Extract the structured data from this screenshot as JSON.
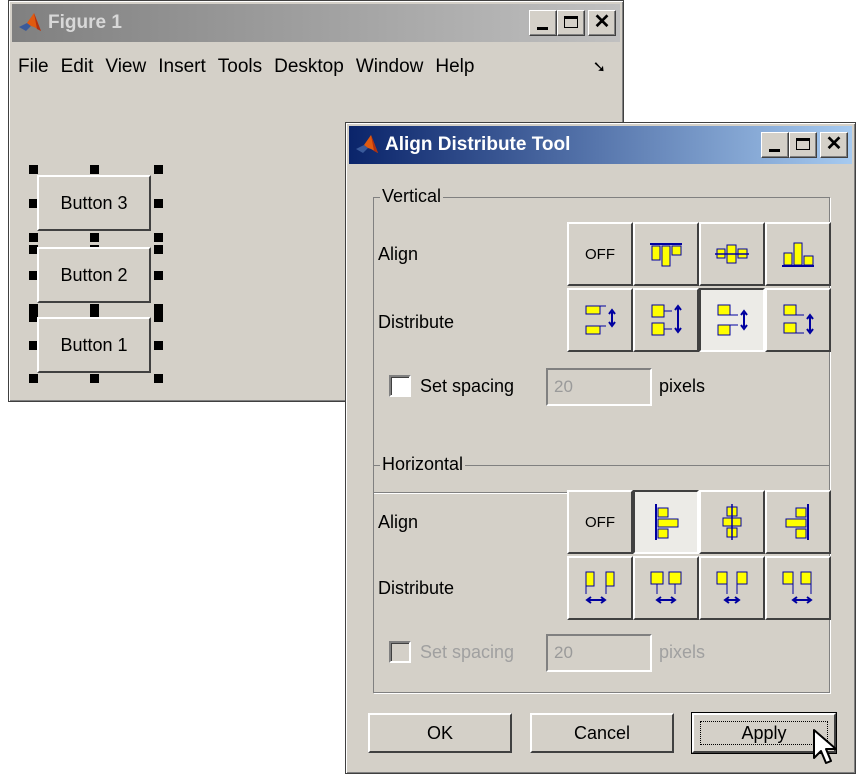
{
  "figure": {
    "title": "Figure 1",
    "menu": [
      "File",
      "Edit",
      "View",
      "Insert",
      "Tools",
      "Desktop",
      "Window",
      "Help"
    ],
    "dock_icon": "dock-arrow-icon",
    "buttons": [
      {
        "label": "Button 3"
      },
      {
        "label": "Button 2"
      },
      {
        "label": "Button 1"
      }
    ]
  },
  "dialog": {
    "title": "Align Distribute Tool",
    "vertical": {
      "legend": "Vertical",
      "align_label": "Align",
      "distribute_label": "Distribute",
      "off_label": "OFF",
      "set_spacing_label": "Set spacing",
      "spacing_value": "20",
      "units_label": "pixels",
      "set_spacing_checked": false
    },
    "horizontal": {
      "legend": "Horizontal",
      "align_label": "Align",
      "distribute_label": "Distribute",
      "off_label": "OFF",
      "set_spacing_label": "Set spacing",
      "spacing_value": "20",
      "units_label": "pixels",
      "set_spacing_checked": false
    },
    "ok_label": "OK",
    "cancel_label": "Cancel",
    "apply_label": "Apply"
  },
  "colors": {
    "accent_yellow": "#ffff00",
    "accent_blue": "#0000a0",
    "title_active": "#0a246a",
    "title_inactive": "#808080"
  }
}
